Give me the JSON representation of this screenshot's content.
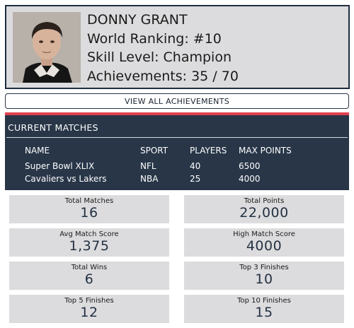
{
  "profile": {
    "name": "DONNY GRANT",
    "world_ranking": "World Ranking: #10",
    "skill_level": "Skill Level: Champion",
    "achievements": "Achievements: 35 / 70"
  },
  "view_all_button": "VIEW ALL ACHIEVEMENTS",
  "current_matches": {
    "title": "CURRENT MATCHES",
    "columns": [
      "NAME",
      "SPORT",
      "PLAYERS",
      "MAX POINTS"
    ],
    "rows": [
      [
        "Super Bowl XLIX",
        "NFL",
        "40",
        "6500"
      ],
      [
        "Cavaliers vs Lakers",
        "NBA",
        "25",
        "4000"
      ]
    ]
  },
  "stats": [
    {
      "label": "Total Matches",
      "value": "16"
    },
    {
      "label": "Total Points",
      "value": "22,000"
    },
    {
      "label": "Avg Match Score",
      "value": "1,375"
    },
    {
      "label": "High Match Score",
      "value": "4000"
    },
    {
      "label": "Total Wins",
      "value": "6"
    },
    {
      "label": "Top 3 Finishes",
      "value": "10"
    },
    {
      "label": "Top 5 Finishes",
      "value": "12"
    },
    {
      "label": "Top 10 Finishes",
      "value": "15"
    }
  ],
  "colors": {
    "panel_bg": "#dcdcde",
    "navy": "#283648",
    "accent_red": "#e2404f"
  }
}
